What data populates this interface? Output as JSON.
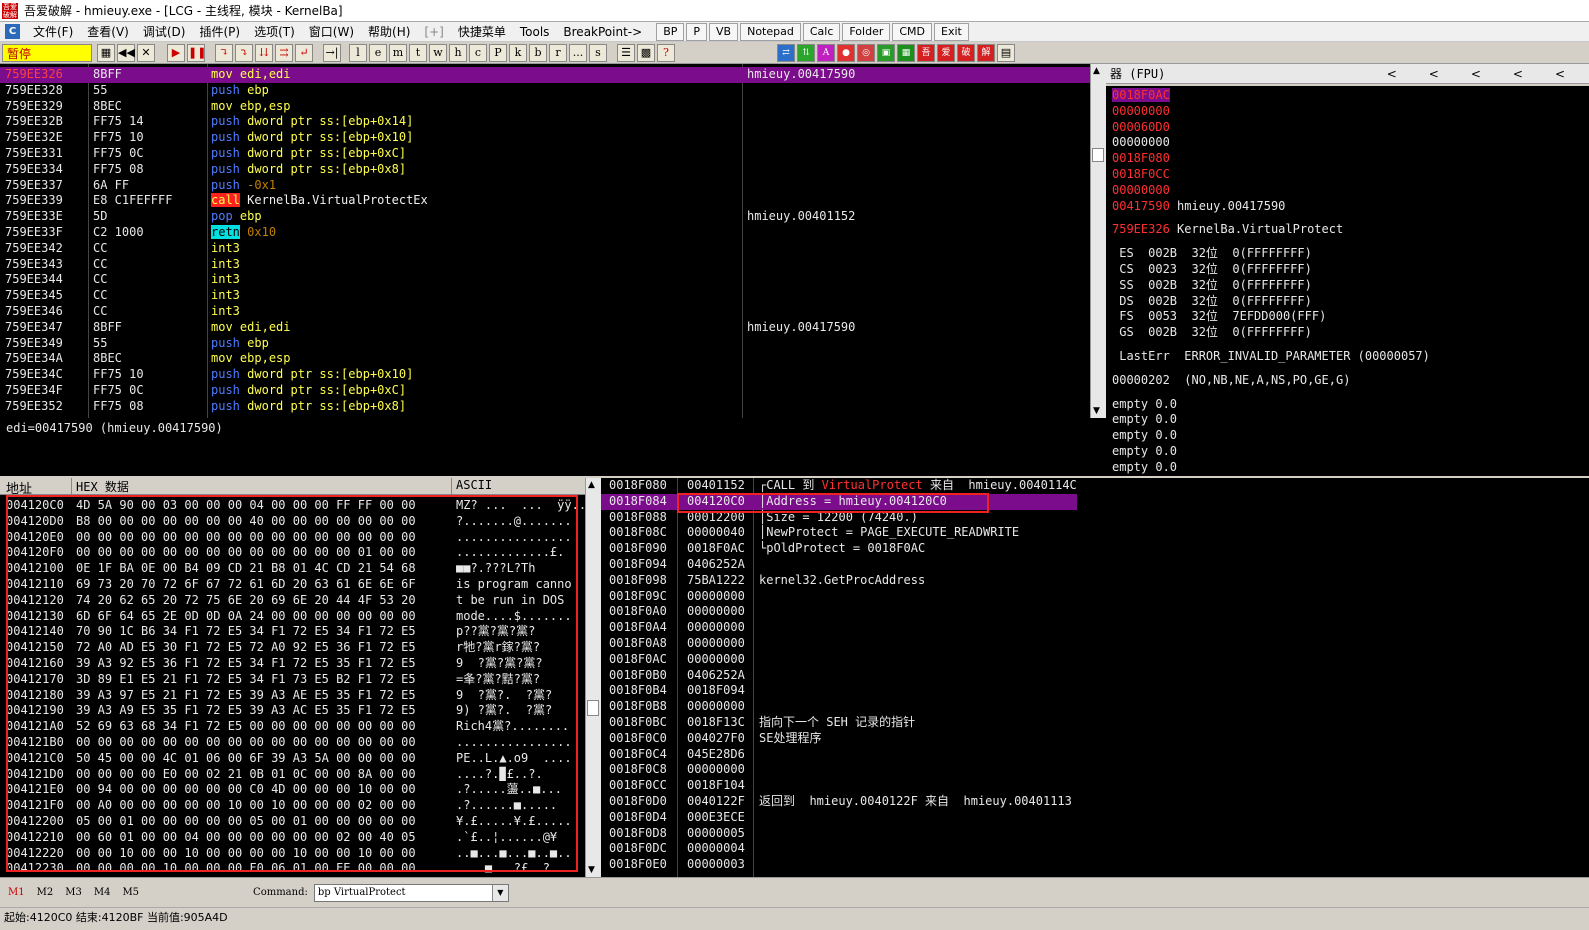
{
  "window": {
    "title": "吾爱破解 - hmieuy.exe - [LCG - 主线程, 模块 - KernelBa]",
    "icon_text": "吾爱破解"
  },
  "menu": {
    "items": [
      "文件(F)",
      "查看(V)",
      "调试(D)",
      "插件(P)",
      "选项(T)",
      "窗口(W)",
      "帮助(H)",
      "[+]",
      "快捷菜单",
      "Tools",
      "BreakPoint->"
    ],
    "buttons": [
      "BP",
      "P",
      "VB",
      "Notepad",
      "Calc",
      "Folder",
      "CMD",
      "Exit"
    ]
  },
  "toolbar": {
    "status": "暂停",
    "letters": [
      "l",
      "e",
      "m",
      "t",
      "w",
      "h",
      "c",
      "P",
      "k",
      "b",
      "r",
      "...",
      "s"
    ]
  },
  "cpu": {
    "rows": [
      {
        "addr": "759EE326",
        "bytes": "8BFF",
        "op": "mov",
        "args": "edi,edi",
        "op_color": "yellow",
        "comment": "hmieuy.00417590",
        "selected": true
      },
      {
        "addr": "759EE328",
        "bytes": "55",
        "op": "push",
        "args": "ebp",
        "op_color": "blue",
        "comment": ""
      },
      {
        "addr": "759EE329",
        "bytes": "8BEC",
        "op": "mov",
        "args": "ebp,esp",
        "op_color": "yellow",
        "comment": ""
      },
      {
        "addr": "759EE32B",
        "bytes": "FF75 14",
        "op": "push",
        "args": "dword ptr ss:[ebp+0x14]",
        "op_color": "blue",
        "comment": ""
      },
      {
        "addr": "759EE32E",
        "bytes": "FF75 10",
        "op": "push",
        "args": "dword ptr ss:[ebp+0x10]",
        "op_color": "blue",
        "comment": ""
      },
      {
        "addr": "759EE331",
        "bytes": "FF75 0C",
        "op": "push",
        "args": "dword ptr ss:[ebp+0xC]",
        "op_color": "blue",
        "comment": ""
      },
      {
        "addr": "759EE334",
        "bytes": "FF75 08",
        "op": "push",
        "args": "dword ptr ss:[ebp+0x8]",
        "op_color": "blue",
        "comment": ""
      },
      {
        "addr": "759EE337",
        "bytes": "6A FF",
        "op": "push",
        "args": "-0x1",
        "op_color": "blue",
        "comment": ""
      },
      {
        "addr": "759EE339",
        "bytes": "E8 C1FEFFFF",
        "op": "call",
        "args": "KernelBa.VirtualProtectEx",
        "op_color": "call",
        "comment": ""
      },
      {
        "addr": "759EE33E",
        "bytes": "5D",
        "op": "pop",
        "args": "ebp",
        "op_color": "blue",
        "comment": "hmieuy.00401152"
      },
      {
        "addr": "759EE33F",
        "bytes": "C2 1000",
        "op": "retn",
        "args": "0x10",
        "op_color": "retn",
        "comment": ""
      },
      {
        "addr": "759EE342",
        "bytes": "CC",
        "op": "int3",
        "args": "",
        "op_color": "yellow",
        "comment": ""
      },
      {
        "addr": "759EE343",
        "bytes": "CC",
        "op": "int3",
        "args": "",
        "op_color": "yellow",
        "comment": ""
      },
      {
        "addr": "759EE344",
        "bytes": "CC",
        "op": "int3",
        "args": "",
        "op_color": "yellow",
        "comment": ""
      },
      {
        "addr": "759EE345",
        "bytes": "CC",
        "op": "int3",
        "args": "",
        "op_color": "yellow",
        "comment": ""
      },
      {
        "addr": "759EE346",
        "bytes": "CC",
        "op": "int3",
        "args": "",
        "op_color": "yellow",
        "comment": ""
      },
      {
        "addr": "759EE347",
        "bytes": "8BFF",
        "op": "mov",
        "args": "edi,edi",
        "op_color": "yellow",
        "comment": "hmieuy.00417590"
      },
      {
        "addr": "759EE349",
        "bytes": "55",
        "op": "push",
        "args": "ebp",
        "op_color": "blue",
        "comment": ""
      },
      {
        "addr": "759EE34A",
        "bytes": "8BEC",
        "op": "mov",
        "args": "ebp,esp",
        "op_color": "yellow",
        "comment": ""
      },
      {
        "addr": "759EE34C",
        "bytes": "FF75 10",
        "op": "push",
        "args": "dword ptr ss:[ebp+0x10]",
        "op_color": "blue",
        "comment": ""
      },
      {
        "addr": "759EE34F",
        "bytes": "FF75 0C",
        "op": "push",
        "args": "dword ptr ss:[ebp+0xC]",
        "op_color": "blue",
        "comment": ""
      },
      {
        "addr": "759EE352",
        "bytes": "FF75 08",
        "op": "push",
        "args": "dword ptr ss:[ebp+0x8]",
        "op_color": "blue",
        "comment": ""
      }
    ]
  },
  "info": {
    "line": "edi=00417590 (hmieuy.00417590)"
  },
  "registers": {
    "header": "器 (FPU)",
    "header_arrows": [
      "<",
      "<",
      "<",
      "<",
      "<"
    ],
    "rows": [
      {
        "text": "0018F0AC",
        "color": "red",
        "hl": true
      },
      {
        "text": "00000000",
        "color": "red"
      },
      {
        "text": "000060D0",
        "color": "red"
      },
      {
        "text": "00000000",
        "color": "white"
      },
      {
        "text": "0018F080",
        "color": "red"
      },
      {
        "text": "0018F0CC",
        "color": "red"
      },
      {
        "text": "00000000",
        "color": "red"
      },
      {
        "text": "00417590",
        "color": "red",
        "extra": "hmieuy.00417590"
      },
      {
        "text": "",
        "color": "white"
      },
      {
        "text": "759EE326",
        "color": "red",
        "extra": "KernelBa.VirtualProtect"
      },
      {
        "text": "",
        "color": "white"
      },
      {
        "text": " ES  002B  32位  0(FFFFFFFF)",
        "color": "white"
      },
      {
        "text": " CS  0023  32位  0(FFFFFFFF)",
        "color": "white"
      },
      {
        "text": " SS  002B  32位  0(FFFFFFFF)",
        "color": "white"
      },
      {
        "text": " DS  002B  32位  0(FFFFFFFF)",
        "color": "white"
      },
      {
        "text": " FS  0053  32位  7EFDD000(FFF)",
        "color": "white"
      },
      {
        "text": " GS  002B  32位  0(FFFFFFFF)",
        "color": "white"
      },
      {
        "text": "",
        "color": "white"
      },
      {
        "text": " LastErr  ERROR_INVALID_PARAMETER (00000057)",
        "color": "white"
      },
      {
        "text": "",
        "color": "white"
      },
      {
        "text": "00000202  (NO,NB,NE,A,NS,PO,GE,G)",
        "color": "white"
      },
      {
        "text": "",
        "color": "white"
      },
      {
        "text": "empty 0.0",
        "color": "white"
      },
      {
        "text": "empty 0.0",
        "color": "white"
      },
      {
        "text": "empty 0.0",
        "color": "white"
      },
      {
        "text": "empty 0.0",
        "color": "white"
      },
      {
        "text": "empty 0.0",
        "color": "white"
      }
    ]
  },
  "dump": {
    "headers": [
      "地址",
      "HEX 数据",
      "ASCII"
    ],
    "rows": [
      {
        "addr": "004120C0",
        "hex": "4D 5A 90 00 03 00 00 00 04 00 00 00 FF FF 00 00",
        "ascii": "MZ? ...  ...  ÿÿ.."
      },
      {
        "addr": "004120D0",
        "hex": "B8 00 00 00 00 00 00 00 40 00 00 00 00 00 00 00",
        "ascii": "?.......@......."
      },
      {
        "addr": "004120E0",
        "hex": "00 00 00 00 00 00 00 00 00 00 00 00 00 00 00 00",
        "ascii": "................"
      },
      {
        "addr": "004120F0",
        "hex": "00 00 00 00 00 00 00 00 00 00 00 00 00 01 00 00",
        "ascii": ".............£."
      },
      {
        "addr": "00412100",
        "hex": "0E 1F BA 0E 00 B4 09 CD 21 B8 01 4C CD 21 54 68",
        "ascii": "■■?.???L?Th"
      },
      {
        "addr": "00412110",
        "hex": "69 73 20 70 72 6F 67 72 61 6D 20 63 61 6E 6E 6F",
        "ascii": "is program canno"
      },
      {
        "addr": "00412120",
        "hex": "74 20 62 65 20 72 75 6E 20 69 6E 20 44 4F 53 20",
        "ascii": "t be run in DOS "
      },
      {
        "addr": "00412130",
        "hex": "6D 6F 64 65 2E 0D 0D 0A 24 00 00 00 00 00 00 00",
        "ascii": "mode....$......."
      },
      {
        "addr": "00412140",
        "hex": "70 90 1C B6 34 F1 72 E5 34 F1 72 E5 34 F1 72 E5",
        "ascii": "p??黨?黨?黨?"
      },
      {
        "addr": "00412150",
        "hex": "72 A0 AD E5 30 F1 72 E5 72 A0 92 E5 36 F1 72 E5",
        "ascii": "r牠?黨r鎵?黨?"
      },
      {
        "addr": "00412160",
        "hex": "39 A3 92 E5 36 F1 72 E5 34 F1 72 E5 35 F1 72 E5",
        "ascii": "9  ?黨?黨?黨?"
      },
      {
        "addr": "00412170",
        "hex": "3D 89 E1 E5 21 F1 72 E5 34 F1 73 E5 B2 F1 72 E5",
        "ascii": "=夆?黨?黠?黨?"
      },
      {
        "addr": "00412180",
        "hex": "39 A3 97 E5 21 F1 72 E5 39 A3 AE E5 35 F1 72 E5",
        "ascii": "9  ?黨?.  ?黨?"
      },
      {
        "addr": "00412190",
        "hex": "39 A3 A9 E5 35 F1 72 E5 39 A3 AC E5 35 F1 72 E5",
        "ascii": "9) ?黨?.  ?黨?"
      },
      {
        "addr": "004121A0",
        "hex": "52 69 63 68 34 F1 72 E5 00 00 00 00 00 00 00 00",
        "ascii": "Rich4黨?........"
      },
      {
        "addr": "004121B0",
        "hex": "00 00 00 00 00 00 00 00 00 00 00 00 00 00 00 00",
        "ascii": "................"
      },
      {
        "addr": "004121C0",
        "hex": "50 45 00 00 4C 01 06 00 6F 39 A3 5A 00 00 00 00",
        "ascii": "PE..L.▲.o9  ...."
      },
      {
        "addr": "004121D0",
        "hex": "00 00 00 00 E0 00 02 21 0B 01 0C 00 00 8A 00 00",
        "ascii": "....?.▉£..?."
      },
      {
        "addr": "004121E0",
        "hex": "00 94 00 00 00 00 00 00 C0 4D 00 00 00 10 00 00",
        "ascii": ".?.....蘯..■..."
      },
      {
        "addr": "004121F0",
        "hex": "00 A0 00 00 00 00 00 10 00 10 00 00 00 02 00 00",
        "ascii": ".?......■....."
      },
      {
        "addr": "00412200",
        "hex": "05 00 01 00 00 00 00 00 05 00 01 00 00 00 00 00",
        "ascii": "¥.£.....¥.£....."
      },
      {
        "addr": "00412210",
        "hex": "00 60 01 00 00 04 00 00 00 00 00 00 02 00 40 05",
        "ascii": ".`£..¦......@¥"
      },
      {
        "addr": "00412220",
        "hex": "00 00 10 00 00 10 00 00 00 00 10 00 00 10 00 00",
        "ascii": "..■...■...■..■.."
      },
      {
        "addr": "00412230",
        "hex": "00 00 00 00 10 00 00 00 F0 06 01 00 EE 00 00 00",
        "ascii": "....■...?£..?."
      }
    ]
  },
  "stack": {
    "rows": [
      {
        "addr": "0018F080",
        "val": "00401152",
        "cmt_pre": "┌CALL 到 ",
        "cmt_red": "VirtualProtect",
        "cmt_post": " 来自  hmieuy.0040114C"
      },
      {
        "addr": "0018F084",
        "val": "004120C0",
        "cmt_pre": "│Address = hmieuy.004120C0",
        "cmt_red": "",
        "cmt_post": "",
        "selected": true
      },
      {
        "addr": "0018F088",
        "val": "00012200",
        "cmt_pre": "│Size = 12200 (74240.)",
        "cmt_red": "",
        "cmt_post": ""
      },
      {
        "addr": "0018F08C",
        "val": "00000040",
        "cmt_pre": "│NewProtect = PAGE_EXECUTE_READWRITE",
        "cmt_red": "",
        "cmt_post": ""
      },
      {
        "addr": "0018F090",
        "val": "0018F0AC",
        "cmt_pre": "└pOldProtect = 0018F0AC",
        "cmt_red": "",
        "cmt_post": ""
      },
      {
        "addr": "0018F094",
        "val": "0406252A",
        "cmt_pre": "",
        "cmt_red": "",
        "cmt_post": ""
      },
      {
        "addr": "0018F098",
        "val": "75BA1222",
        "cmt_pre": "kernel32.GetProcAddress",
        "cmt_red": "",
        "cmt_post": ""
      },
      {
        "addr": "0018F09C",
        "val": "00000000",
        "cmt_pre": "",
        "cmt_red": "",
        "cmt_post": ""
      },
      {
        "addr": "0018F0A0",
        "val": "00000000",
        "cmt_pre": "",
        "cmt_red": "",
        "cmt_post": ""
      },
      {
        "addr": "0018F0A4",
        "val": "00000000",
        "cmt_pre": "",
        "cmt_red": "",
        "cmt_post": ""
      },
      {
        "addr": "0018F0A8",
        "val": "00000000",
        "cmt_pre": "",
        "cmt_red": "",
        "cmt_post": ""
      },
      {
        "addr": "0018F0AC",
        "val": "00000000",
        "cmt_pre": "",
        "cmt_red": "",
        "cmt_post": ""
      },
      {
        "addr": "0018F0B0",
        "val": "0406252A",
        "cmt_pre": "",
        "cmt_red": "",
        "cmt_post": ""
      },
      {
        "addr": "0018F0B4",
        "val": "0018F094",
        "cmt_pre": "",
        "cmt_red": "",
        "cmt_post": ""
      },
      {
        "addr": "0018F0B8",
        "val": "00000000",
        "cmt_pre": "",
        "cmt_red": "",
        "cmt_post": ""
      },
      {
        "addr": "0018F0BC",
        "val": "0018F13C",
        "cmt_pre": "指向下一个 SEH 记录的指针",
        "cmt_red": "",
        "cmt_post": ""
      },
      {
        "addr": "0018F0C0",
        "val": "004027F0",
        "cmt_pre": "SE处理程序",
        "cmt_red": "",
        "cmt_post": ""
      },
      {
        "addr": "0018F0C4",
        "val": "045E28D6",
        "cmt_pre": "",
        "cmt_red": "",
        "cmt_post": ""
      },
      {
        "addr": "0018F0C8",
        "val": "00000000",
        "cmt_pre": "",
        "cmt_red": "",
        "cmt_post": ""
      },
      {
        "addr": "0018F0CC",
        "val": "0018F104",
        "cmt_pre": "",
        "cmt_red": "",
        "cmt_post": ""
      },
      {
        "addr": "0018F0D0",
        "val": "0040122F",
        "cmt_pre": "返回到  hmieuy.0040122F 来自  hmieuy.00401113",
        "cmt_red": "",
        "cmt_post": ""
      },
      {
        "addr": "0018F0D4",
        "val": "000E3ECE",
        "cmt_pre": "",
        "cmt_red": "",
        "cmt_post": ""
      },
      {
        "addr": "0018F0D8",
        "val": "00000005",
        "cmt_pre": "",
        "cmt_red": "",
        "cmt_post": ""
      },
      {
        "addr": "0018F0DC",
        "val": "00000004",
        "cmt_pre": "",
        "cmt_red": "",
        "cmt_post": ""
      },
      {
        "addr": "0018F0E0",
        "val": "00000003",
        "cmt_pre": "",
        "cmt_red": "",
        "cmt_post": ""
      }
    ]
  },
  "bottom": {
    "tabs": [
      "M1",
      "M2",
      "M3",
      "M4",
      "M5"
    ],
    "command_label": "Command:",
    "command_value": "bp VirtualProtect"
  },
  "statusline": "起始:4120C0 结束:4120BF 当前值:905A4D",
  "colors": {
    "selection": "#7b0c8b",
    "red_box": "#e22222",
    "call_bg": "#ff2020",
    "retn_bg": "#00e0e0"
  }
}
